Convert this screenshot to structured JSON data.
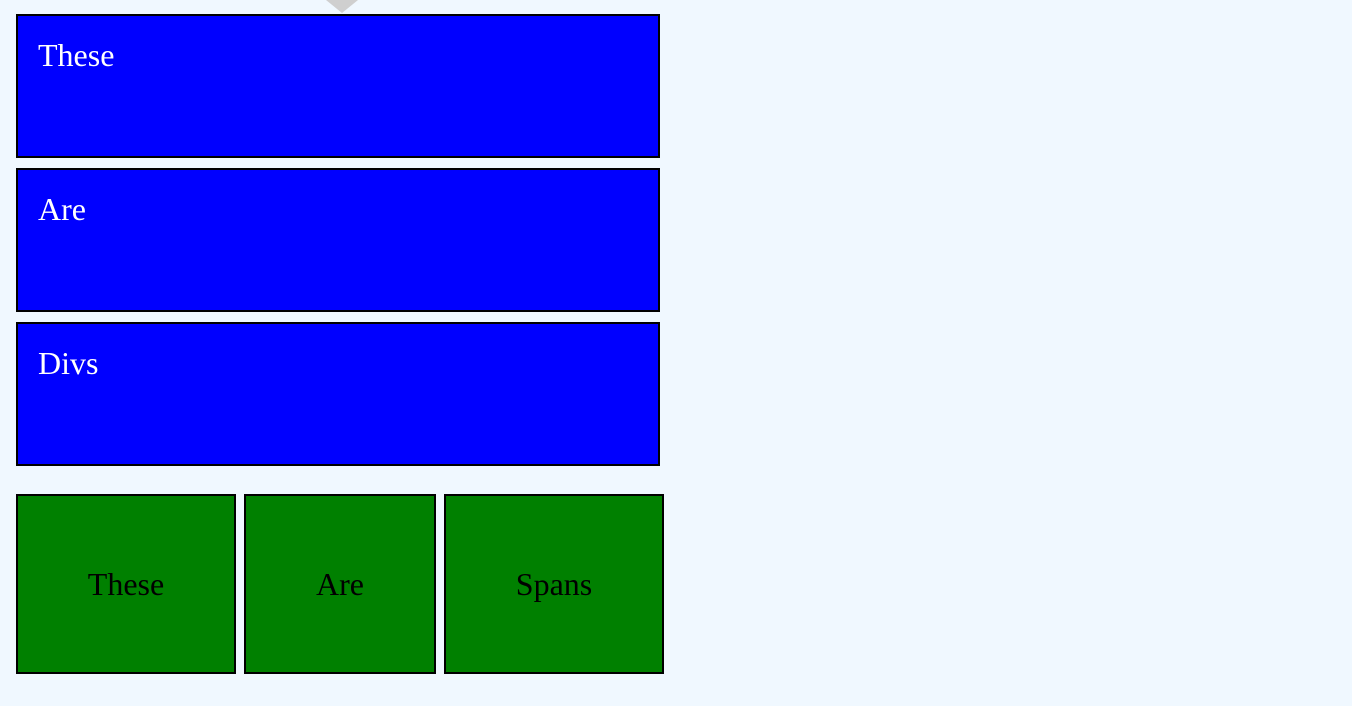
{
  "divs": [
    {
      "label": "These"
    },
    {
      "label": "Are"
    },
    {
      "label": "Divs"
    }
  ],
  "spans": [
    {
      "label": "These"
    },
    {
      "label": "Are"
    },
    {
      "label": "Spans"
    }
  ],
  "colors": {
    "background": "#f0f8ff",
    "div_fill": "#0000ff",
    "span_fill": "#008000",
    "div_text": "#ffffff",
    "span_text": "#000000",
    "border": "#000000",
    "notch": "#cfcfcf"
  }
}
